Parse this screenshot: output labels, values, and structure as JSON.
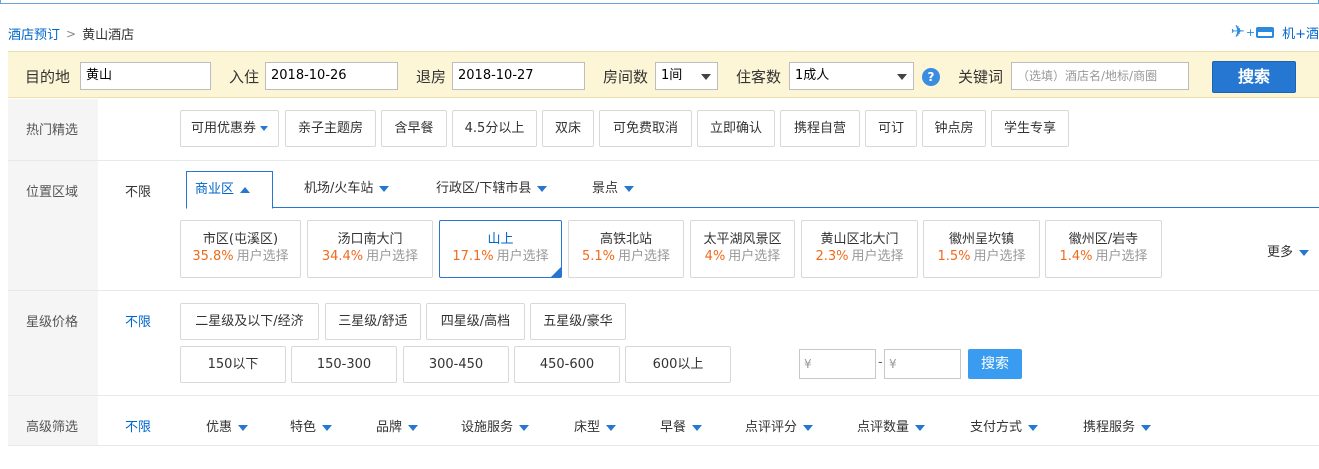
{
  "breadcrumb": {
    "home": "酒店预订",
    "sep": ">",
    "current": "黄山酒店"
  },
  "promo": {
    "label": "机+酒",
    "plane_icon": "✈",
    "plus": "+"
  },
  "search": {
    "dest_label": "目的地",
    "dest_value": "黄山",
    "checkin_label": "入住",
    "checkin_value": "2018-10-26",
    "checkout_label": "退房",
    "checkout_value": "2018-10-27",
    "rooms_label": "房间数",
    "rooms_value": "1间",
    "guests_label": "住客数",
    "guests_value": "1成人",
    "help": "?",
    "keyword_label": "关键词",
    "keyword_placeholder": "（选填）酒店名/地标/商圈",
    "button": "搜索"
  },
  "hot": {
    "label": "热门精选",
    "tags": [
      "可用优惠券",
      "亲子主题房",
      "含早餐",
      "4.5分以上",
      "双床",
      "可免费取消",
      "立即确认",
      "携程自营",
      "可订",
      "钟点房",
      "学生专享"
    ]
  },
  "location": {
    "label": "位置区域",
    "unlimited": "不限",
    "tabs": [
      "商业区",
      "机场/火车站",
      "行政区/下辖市县",
      "景点"
    ],
    "zones": [
      {
        "name": "市区(屯溪区)",
        "pct": "35.8%",
        "text": "用户选择"
      },
      {
        "name": "汤口南大门",
        "pct": "34.4%",
        "text": "用户选择"
      },
      {
        "name": "山上",
        "pct": "17.1%",
        "text": "用户选择"
      },
      {
        "name": "高铁北站",
        "pct": "5.1%",
        "text": "用户选择"
      },
      {
        "name": "太平湖风景区",
        "pct": "4%",
        "text": "用户选择"
      },
      {
        "name": "黄山区北大门",
        "pct": "2.3%",
        "text": "用户选择"
      },
      {
        "name": "徽州呈坎镇",
        "pct": "1.5%",
        "text": "用户选择"
      },
      {
        "name": "徽州区/岩寺",
        "pct": "1.4%",
        "text": "用户选择"
      }
    ],
    "more": "更多"
  },
  "star": {
    "label": "星级价格",
    "unlimited": "不限",
    "stars": [
      "二星级及以下/经济",
      "三星级/舒适",
      "四星级/高档",
      "五星级/豪华"
    ],
    "prices": [
      "150以下",
      "150-300",
      "300-450",
      "450-600",
      "600以上"
    ],
    "min_placeholder": "¥",
    "max_placeholder": "¥",
    "dash": "-",
    "button": "搜索"
  },
  "advanced": {
    "label": "高级筛选",
    "unlimited": "不限",
    "filters": [
      "优惠",
      "特色",
      "品牌",
      "设施服务",
      "床型",
      "早餐",
      "点评评分",
      "点评数量",
      "支付方式",
      "携程服务"
    ]
  },
  "colors": {
    "accent": "#2577d1",
    "highlight": "#f06a1d",
    "bar": "#fdf6d6"
  }
}
